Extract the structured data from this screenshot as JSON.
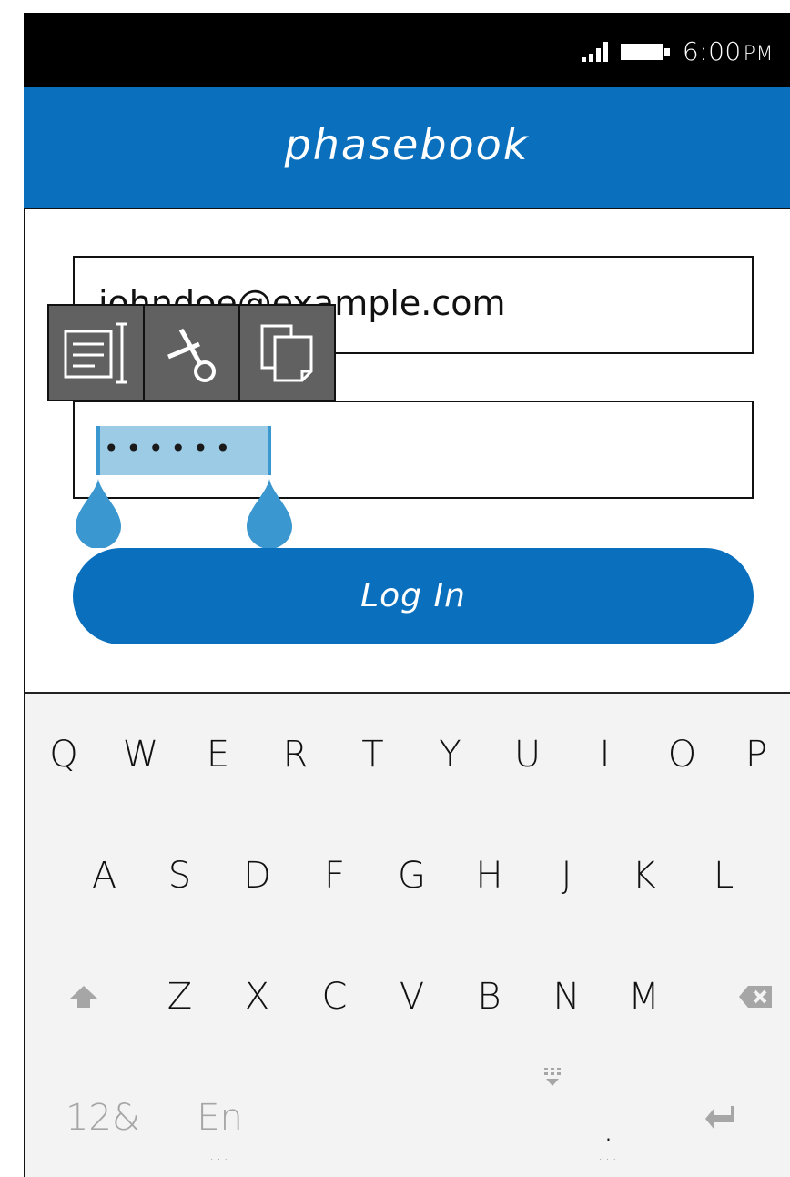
{
  "status": {
    "time": "6:00",
    "ampm": "PM"
  },
  "app": {
    "title": "phasebook"
  },
  "form": {
    "email_value": "johndoe@example.com",
    "password_mask": "••••••",
    "login_label": "Log In"
  },
  "context_menu": {
    "items": [
      "select-all",
      "cut",
      "copy"
    ]
  },
  "keyboard": {
    "row1": [
      "Q",
      "W",
      "E",
      "R",
      "T",
      "Y",
      "U",
      "I",
      "O",
      "P"
    ],
    "row2": [
      "A",
      "S",
      "D",
      "F",
      "G",
      "H",
      "J",
      "K",
      "L"
    ],
    "row3": [
      "Z",
      "X",
      "C",
      "V",
      "B",
      "N",
      "M"
    ],
    "row4": {
      "numbers": "12&",
      "lang": "En",
      "period": ".",
      "ellipsis": "..."
    }
  },
  "colors": {
    "brand": "#0a6fbd",
    "selection": "#9ccbe6",
    "handle": "#3a97d0"
  }
}
